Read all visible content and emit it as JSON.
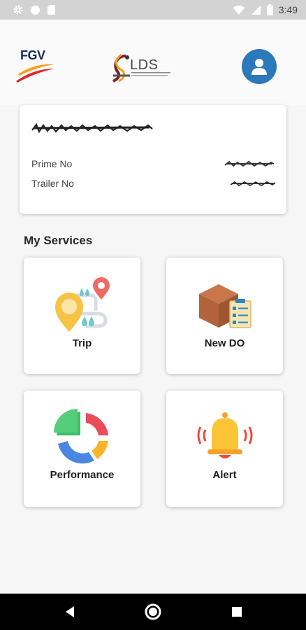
{
  "status_bar": {
    "time": "3:49",
    "icons": [
      "gear-icon",
      "circle-icon",
      "sd-card-icon",
      "wifi-icon",
      "signal-icon",
      "battery-icon"
    ]
  },
  "header": {
    "left_logo_text": "FGV",
    "center_logo_text": "iLDS",
    "avatar_icon": "user-icon",
    "accent_color": "#2b78ba"
  },
  "vehicle_card": {
    "prime_label": "Prime No",
    "trailer_label": "Trailer No"
  },
  "services": {
    "title": "My Services",
    "items": [
      {
        "label": "Trip",
        "icon": "route-map-icon"
      },
      {
        "label": "New DO",
        "icon": "box-checklist-icon"
      },
      {
        "label": "Performance",
        "icon": "pie-chart-icon"
      },
      {
        "label": "Alert",
        "icon": "bell-icon"
      }
    ]
  },
  "nav_bar": {
    "buttons": [
      "back-button",
      "home-button",
      "recents-button"
    ]
  }
}
